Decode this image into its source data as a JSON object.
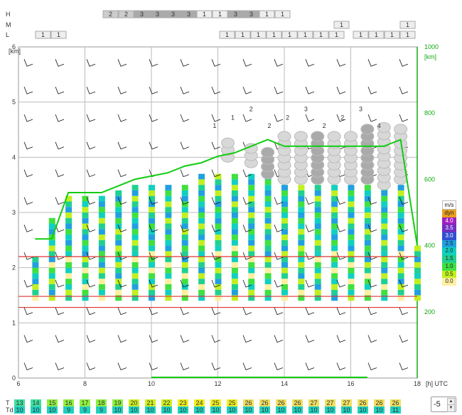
{
  "rows": {
    "H": {
      "label": "H",
      "cells": [
        "2",
        "2",
        "3",
        "3",
        "3",
        "3",
        "1",
        "1",
        "3",
        "3",
        "1",
        "1"
      ]
    },
    "M": {
      "label": "M",
      "cells": [
        "1",
        "1"
      ]
    },
    "L": {
      "label": "L",
      "cells": [
        "1",
        "1",
        "1",
        "1",
        "1",
        "1",
        "1",
        "1",
        "1",
        "1",
        "1",
        "1",
        "1",
        "1",
        "1"
      ]
    }
  },
  "axes": {
    "left_ticks": [
      "0",
      "1",
      "2",
      "3",
      "4",
      "5",
      "6"
    ],
    "left_unit": "[km]",
    "right_ticks": [
      "200",
      "400",
      "600",
      "800",
      "1000"
    ],
    "right_unit": "[km]",
    "x_ticks": [
      "6",
      "8",
      "10",
      "12",
      "14",
      "16",
      "18"
    ],
    "x_unit": "[h] UTC"
  },
  "cloud_numbers": [
    "1",
    "1",
    "2",
    "2",
    "2",
    "3",
    "2",
    "2",
    "3",
    "4"
  ],
  "legend": {
    "title": "m/s",
    "items": [
      {
        "label": "dyn",
        "color": "#e8a020"
      },
      {
        "label": "4.0",
        "color": "#a020c0"
      },
      {
        "label": "3.5",
        "color": "#7030c0"
      },
      {
        "label": "3.0",
        "color": "#3050d0"
      },
      {
        "label": "2.5",
        "color": "#20a0e0"
      },
      {
        "label": "2.0",
        "color": "#10d0c0"
      },
      {
        "label": "1.5",
        "color": "#20d090"
      },
      {
        "label": "1.0",
        "color": "#40e040"
      },
      {
        "label": "0.5",
        "color": "#c0f020"
      },
      {
        "label": "0.0",
        "color": "#fff0a0"
      }
    ]
  },
  "bottom": {
    "T_label": "T",
    "Td_label": "Td",
    "T": [
      "13",
      "14",
      "15",
      "16",
      "17",
      "18",
      "19",
      "20",
      "21",
      "22",
      "23",
      "24",
      "25",
      "25",
      "26",
      "26",
      "26",
      "26",
      "27",
      "27",
      "27",
      "26",
      "26",
      "26"
    ],
    "Td": [
      "10",
      "10",
      "10",
      "9",
      "9",
      "9",
      "10",
      "10",
      "10",
      "10",
      "10",
      "10",
      "10",
      "10",
      "10",
      "10",
      "10",
      "10",
      "10",
      "10",
      "10",
      "10",
      "10",
      "11"
    ]
  },
  "stepper": {
    "value": "-5"
  },
  "chart_data": {
    "type": "line",
    "x_unit": "[h] UTC",
    "x": [
      6.5,
      7.0,
      7.5,
      8.0,
      8.5,
      9.0,
      9.5,
      10.0,
      10.5,
      11.0,
      11.5,
      12.0,
      12.5,
      13.0,
      13.5,
      14.0,
      14.5,
      15.0,
      15.5,
      16.0,
      16.5,
      17.0,
      17.5,
      18.0
    ],
    "series": [
      {
        "axis": "right",
        "values": [
          420,
          420,
          560,
          560,
          560,
          580,
          600,
          610,
          620,
          640,
          650,
          670,
          680,
          700,
          720,
          700,
          700,
          700,
          700,
          700,
          700,
          700,
          720,
          400
        ]
      }
    ],
    "ylim_left": [
      0,
      6
    ],
    "ylim_right": [
      0,
      1000
    ],
    "left_axis_unit": "[km]",
    "right_axis_unit": "[km]"
  }
}
